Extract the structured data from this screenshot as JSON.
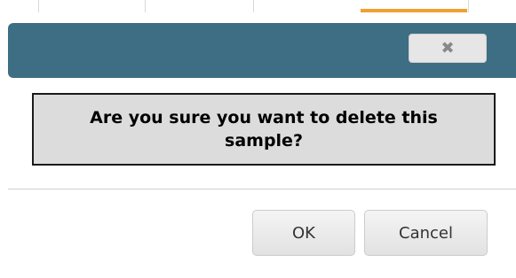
{
  "dialog": {
    "close_icon": "close-icon",
    "close_glyph": "✖",
    "message": "Are you sure you want to delete this sample?",
    "ok_label": "OK",
    "cancel_label": "Cancel"
  },
  "colors": {
    "title_bar": "#3d6e84",
    "accent_tab": "#f0a030",
    "message_bg": "#dcdcdc"
  }
}
